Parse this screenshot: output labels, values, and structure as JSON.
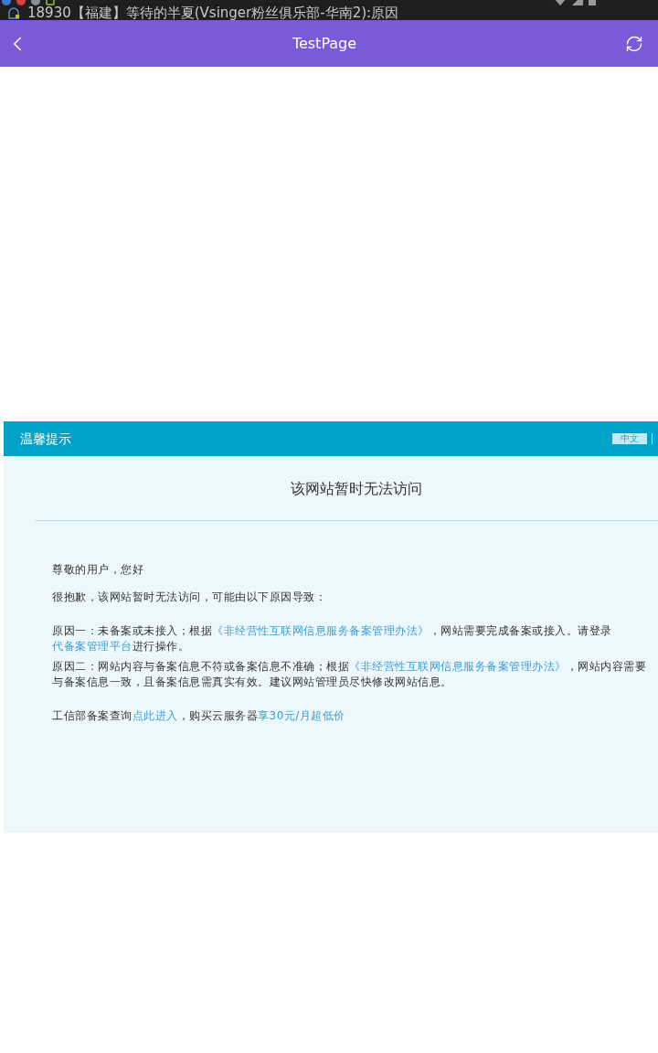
{
  "status_bar": {
    "ticker": "18930【福建】等待的半夏(Vsinger粉丝俱乐部-华南2):原因"
  },
  "nav_bar": {
    "title": "TestPage"
  },
  "notice": {
    "header": {
      "title": "温馨提示",
      "language_button": "中文"
    },
    "heading": "该网站暂时无法访问",
    "sections": [
      {
        "paragraphs": [
          {
            "segments": [
              {
                "kind": "text",
                "text": "尊敬的用户，您好"
              }
            ]
          },
          {
            "segments": [
              {
                "kind": "text",
                "text": "很抱歉，该网站暂时无法访问，可能由以下原因导致："
              }
            ]
          }
        ]
      },
      {
        "paragraphs": [
          {
            "segments": [
              {
                "kind": "text",
                "text": "原因一：未备案或未接入；根据"
              },
              {
                "kind": "link",
                "text": "《非经营性互联网信息服务备案管理办法》"
              },
              {
                "kind": "text",
                "text": "，网站需要完成备案或接入。请登录"
              },
              {
                "kind": "link",
                "text": "代备案管理平台"
              },
              {
                "kind": "text",
                "text": "进行操作。"
              }
            ]
          },
          {
            "segments": [
              {
                "kind": "text",
                "text": "原因二：网站内容与备案信息不符或备案信息不准确；根据"
              },
              {
                "kind": "link",
                "text": "《非经营性互联网信息服务备案管理办法》"
              },
              {
                "kind": "text",
                "text": "，网站内容需要与备案信息一致，且备案信息需真实有效。建议网站管理员尽快修改网站信息。"
              }
            ]
          }
        ]
      },
      {
        "paragraphs": [
          {
            "segments": [
              {
                "kind": "text",
                "text": "工信部备案查询"
              },
              {
                "kind": "link",
                "text": "点此进入"
              },
              {
                "kind": "text",
                "text": "，购买云服务器"
              },
              {
                "kind": "link",
                "text": "享30元/月超低价"
              }
            ]
          }
        ]
      }
    ]
  }
}
